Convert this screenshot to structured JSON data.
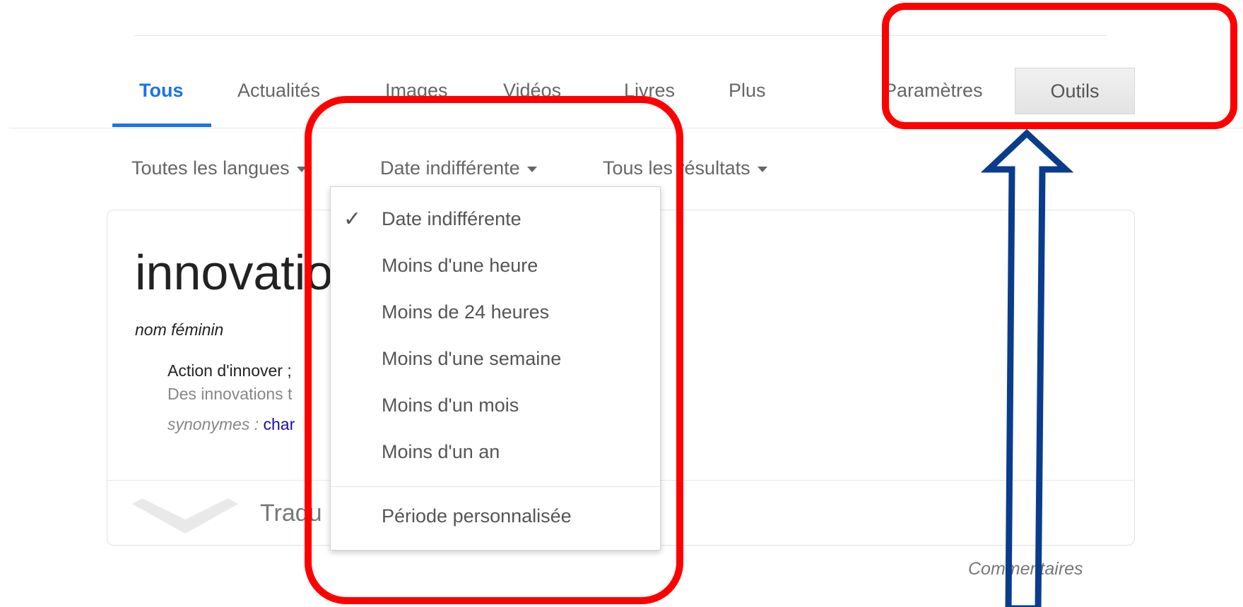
{
  "tabs": [
    "Tous",
    "Actualités",
    "Images",
    "Vidéos",
    "Livres",
    "Plus"
  ],
  "toolbar": {
    "settings_label": "Paramètres",
    "tools_label": "Outils"
  },
  "filters": {
    "language": "Toutes les langues",
    "date": "Date indifférente",
    "results": "Tous les résultats"
  },
  "dropdown": {
    "selected": "Date indifférente",
    "items": [
      "Date indifférente",
      "Moins d'une heure",
      "Moins de 24 heures",
      "Moins d'une semaine",
      "Moins d'un mois",
      "Moins d'un an"
    ],
    "custom": "Période personnalisée"
  },
  "card": {
    "word": "innovatio",
    "part_of_speech": "nom féminin",
    "definition": "Action d'innover ;",
    "example": "Des innovations t",
    "synonyms_label": "synonymes :",
    "synonym": "char",
    "translate_label": "Tradu"
  },
  "footer": {
    "feedback": "Commentaires"
  },
  "colors": {
    "accent": "#1a73e8",
    "highlight": "#ff0000",
    "arrow": "#0a3c8c",
    "link": "#1a0dab"
  }
}
